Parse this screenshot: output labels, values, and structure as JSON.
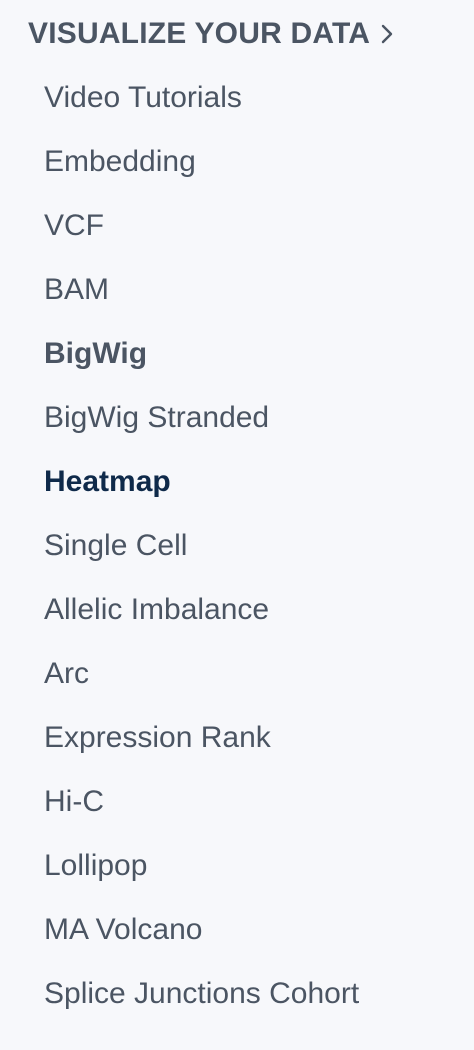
{
  "sidebar": {
    "section_title": "VISUALIZE YOUR DATA",
    "section_icon": "chevron-right-icon",
    "items": [
      {
        "label": "Video Tutorials"
      },
      {
        "label": "Embedding"
      },
      {
        "label": "VCF"
      },
      {
        "label": "BAM"
      },
      {
        "label": "BigWig"
      },
      {
        "label": "BigWig Stranded"
      },
      {
        "label": "Heatmap"
      },
      {
        "label": "Single Cell"
      },
      {
        "label": "Allelic Imbalance"
      },
      {
        "label": "Arc"
      },
      {
        "label": "Expression Rank"
      },
      {
        "label": "Hi-C"
      },
      {
        "label": "Lollipop"
      },
      {
        "label": "MA Volcano"
      },
      {
        "label": "Splice Junctions Cohort"
      }
    ]
  },
  "colors": {
    "background": "#f7f8fb",
    "text": "#4b5563",
    "active_text": "#0f2a4a"
  }
}
